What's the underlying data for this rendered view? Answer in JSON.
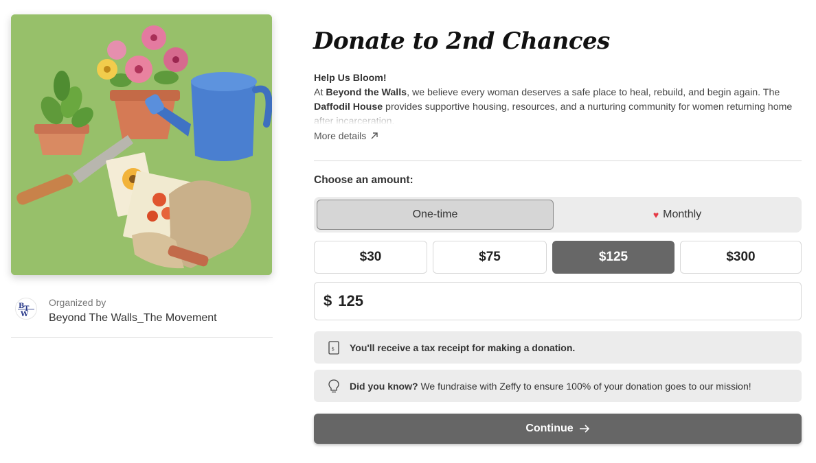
{
  "campaign": {
    "title": "Donate to 2nd Chances",
    "image_alt": "Watercolor garden illustration"
  },
  "organizer": {
    "label": "Organized by",
    "name": "Beyond The Walls_The Movement",
    "logo_text": "BTW"
  },
  "description": {
    "heading": "Help Us Bloom!",
    "p1_prefix": "At ",
    "p1_bold1": "Beyond the Walls",
    "p1_mid": ", we believe every woman deserves a safe place to heal, rebuild, and begin again. The ",
    "p1_bold2": "Daffodil House",
    "p1_suffix": " provides supportive housing, resources, and a nurturing community for women returning home after incarceration.",
    "more_label": "More details"
  },
  "donation": {
    "choose_label": "Choose an amount:",
    "frequency": {
      "one_time": "One-time",
      "monthly": "Monthly",
      "selected": "One-time"
    },
    "amounts": [
      "$30",
      "$75",
      "$125",
      "$300"
    ],
    "selected_amount": "$125",
    "currency_symbol": "$",
    "custom_value": "125"
  },
  "notices": {
    "tax_receipt": "You'll receive a tax receipt for making a donation.",
    "did_you_know_label": "Did you know?",
    "did_you_know_text": " We fundraise with Zeffy to ensure 100% of your donation goes to our mission!"
  },
  "cta": {
    "continue_label": "Continue"
  },
  "colors": {
    "selected_amount_bg": "#676767",
    "continue_bg": "#666666",
    "heart": "#e53945",
    "hero_bg": "#97c06a"
  }
}
